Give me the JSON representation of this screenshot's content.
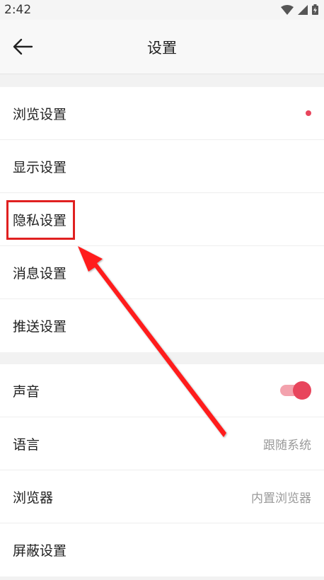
{
  "status_bar": {
    "time": "2:42",
    "icons": [
      "wifi-icon",
      "signal-icon",
      "battery-icon"
    ]
  },
  "header": {
    "title": "设置",
    "back_icon": "arrow-left-icon"
  },
  "section1": {
    "items": [
      {
        "label": "浏览设置",
        "badge": "red-dot"
      },
      {
        "label": "显示设置"
      },
      {
        "label": "隐私设置",
        "highlighted": true
      },
      {
        "label": "消息设置"
      },
      {
        "label": "推送设置"
      }
    ]
  },
  "section2": {
    "items": [
      {
        "label": "声音",
        "toggle": true
      },
      {
        "label": "语言",
        "value": "跟随系统"
      },
      {
        "label": "浏览器",
        "value": "内置浏览器"
      },
      {
        "label": "屏蔽设置"
      }
    ]
  },
  "colors": {
    "accent": "#e8455c",
    "annotation": "#e02020"
  }
}
